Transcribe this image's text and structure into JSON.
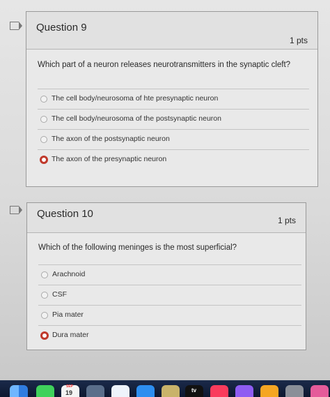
{
  "questions": [
    {
      "title": "Question 9",
      "points": "1 pts",
      "text": "Which part of a neuron releases neurotransmitters in the synaptic cleft?",
      "answers": [
        {
          "label": "The cell body/neurosoma of hte presynaptic neuron",
          "selected": false
        },
        {
          "label": "The cell body/neurosoma of the postsynaptic neuron",
          "selected": false
        },
        {
          "label": "The axon of the postsynaptic neuron",
          "selected": false
        },
        {
          "label": "The axon of the presynaptic neuron",
          "selected": true
        }
      ]
    },
    {
      "title": "Question 10",
      "points": "1 pts",
      "text": "Which of the following meninges is the most superficial?",
      "answers": [
        {
          "label": "Arachnoid",
          "selected": false
        },
        {
          "label": "CSF",
          "selected": false
        },
        {
          "label": "Pia mater",
          "selected": false
        },
        {
          "label": "Dura mater",
          "selected": true
        }
      ]
    }
  ],
  "dock": {
    "calendar_month": "SEP",
    "calendar_day": "19",
    "tv_label": "tv",
    "apps": [
      "finder-icon",
      "messages-icon",
      "calendar-icon",
      "contacts-icon",
      "reminders-icon",
      "keynote-icon",
      "tv-icon",
      "music-icon",
      "podcasts-icon",
      "books-icon"
    ]
  },
  "colors": {
    "selected_radio": "#c0392b",
    "card_bg": "#e9e9e9",
    "dock_bg": "#0d1830"
  }
}
